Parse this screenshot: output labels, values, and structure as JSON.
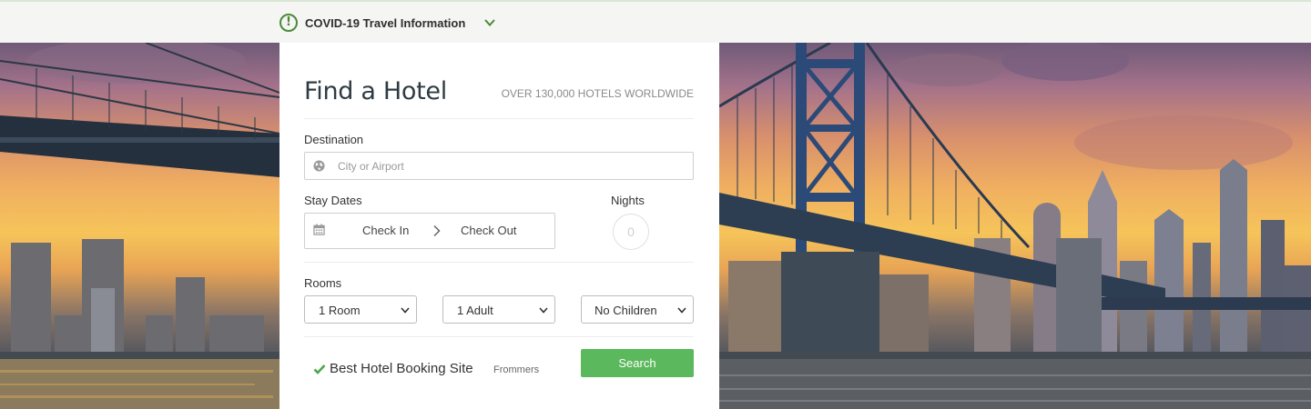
{
  "notice": {
    "icon": "exclamation-circle-icon",
    "text": "COVID-19 Travel Information",
    "chevron": "chevron-down-icon",
    "accent": "#4a8a37"
  },
  "hero": {
    "scene": "bridge-skyline-sunset"
  },
  "search_card": {
    "title": "Find a Hotel",
    "subtitle": "OVER 130,000 HOTELS WORLDWIDE",
    "destination": {
      "label": "Destination",
      "value": "",
      "placeholder": "City or Airport",
      "icon": "globe-icon"
    },
    "dates": {
      "label": "Stay Dates",
      "icon": "calendar-icon",
      "check_in": "Check In",
      "separator_icon": "chevron-right-icon",
      "check_out": "Check Out"
    },
    "nights": {
      "label": "Nights",
      "value": "0"
    },
    "rooms": {
      "label": "Rooms",
      "rooms_value": "1 Room",
      "adults_value": "1 Adult",
      "children_value": "No Children"
    },
    "badge": {
      "icon": "checkmark-icon",
      "text": "Best Hotel Booking Site",
      "source": "Frommers"
    },
    "search_button": "Search",
    "colors": {
      "button": "#5cb85c",
      "title": "#2f3b43"
    }
  }
}
